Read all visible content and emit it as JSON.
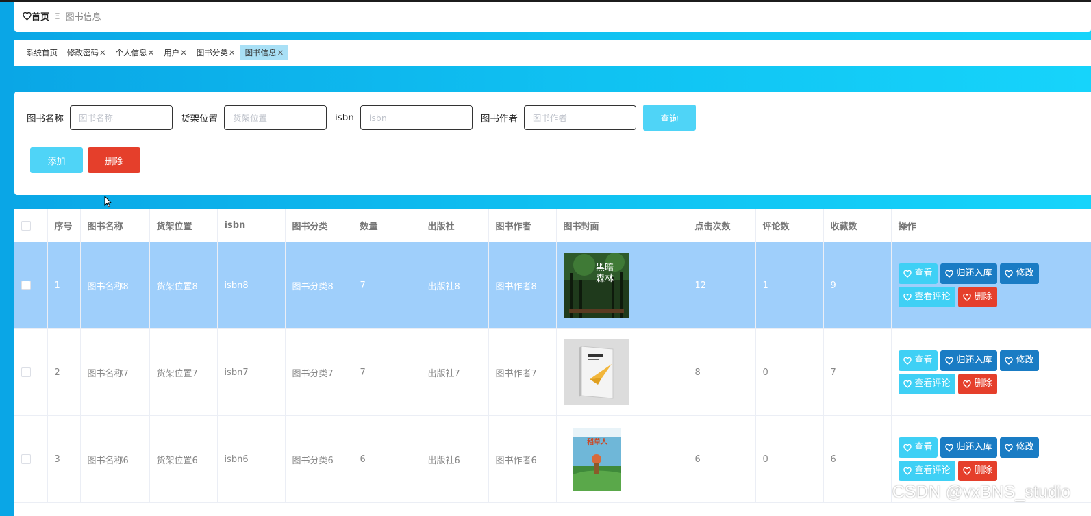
{
  "breadcrumb": {
    "home": "首页",
    "separator": "Ξ",
    "current": "图书信息"
  },
  "tabs": [
    {
      "label": "系统首页",
      "closable": false,
      "active": false
    },
    {
      "label": "修改密码",
      "closable": true,
      "active": false
    },
    {
      "label": "个人信息",
      "closable": true,
      "active": false
    },
    {
      "label": "用户",
      "closable": true,
      "active": false
    },
    {
      "label": "图书分类",
      "closable": true,
      "active": false
    },
    {
      "label": "图书信息",
      "closable": true,
      "active": true
    }
  ],
  "search": {
    "name_label": "图书名称",
    "name_placeholder": "图书名称",
    "shelf_label": "货架位置",
    "shelf_placeholder": "货架位置",
    "isbn_label": "isbn",
    "isbn_placeholder": "isbn",
    "author_label": "图书作者",
    "author_placeholder": "图书作者",
    "query_button": "查询"
  },
  "actions": {
    "add": "添加",
    "delete": "删除"
  },
  "table": {
    "headers": [
      "序号",
      "图书名称",
      "货架位置",
      "isbn",
      "图书分类",
      "数量",
      "出版社",
      "图书作者",
      "图书封面",
      "点击次数",
      "评论数",
      "收藏数",
      "操作"
    ],
    "op_labels": {
      "view": "查看",
      "return": "归还入库",
      "edit": "修改",
      "comments": "查看评论",
      "delete": "删除"
    },
    "rows": [
      {
        "index": "1",
        "name": "图书名称8",
        "shelf": "货架位置8",
        "isbn": "isbn8",
        "category": "图书分类8",
        "quantity": "7",
        "publisher": "出版社8",
        "author": "图书作者8",
        "clicks": "12",
        "comments": "1",
        "favorites": "9",
        "cover_title": "黑暗森林",
        "selected": true
      },
      {
        "index": "2",
        "name": "图书名称7",
        "shelf": "货架位置7",
        "isbn": "isbn7",
        "category": "图书分类7",
        "quantity": "7",
        "publisher": "出版社7",
        "author": "图书作者7",
        "clicks": "8",
        "comments": "0",
        "favorites": "7",
        "cover_title": "",
        "selected": false
      },
      {
        "index": "3",
        "name": "图书名称6",
        "shelf": "货架位置6",
        "isbn": "isbn6",
        "category": "图书分类6",
        "quantity": "6",
        "publisher": "出版社6",
        "author": "图书作者6",
        "clicks": "6",
        "comments": "0",
        "favorites": "6",
        "cover_title": "稻草人",
        "selected": false
      }
    ]
  },
  "watermark": "CSDN @vxBNS_studio",
  "colors": {
    "accent": "#4fd4f7",
    "danger": "#e53f2b",
    "primary": "#1a7cc4",
    "selected_row": "#9fcffb"
  },
  "icons": {
    "home": "heart-icon",
    "button": "heart-icon"
  }
}
